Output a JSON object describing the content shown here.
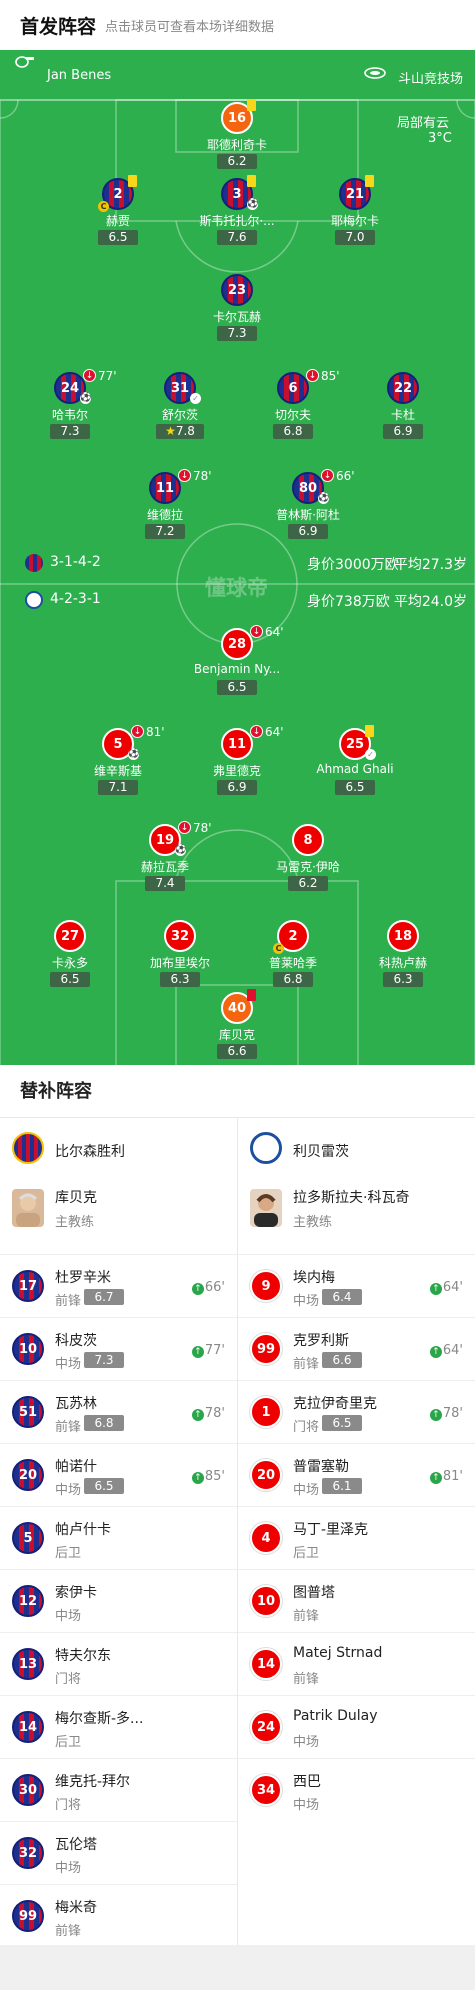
{
  "header": {
    "title": "首发阵容",
    "subtitle": "点击球员可查看本场详细数据"
  },
  "pitch": {
    "referee": "Jan Benes",
    "stadium": "斗山竞技场",
    "weather": "局部有云",
    "temperature": "3°C",
    "watermark": "懂球帝",
    "home": {
      "formation": "3-1-4-2",
      "value": "身价3000万欧",
      "avg_age": "平均27.3岁"
    },
    "away": {
      "formation": "4-2-3-1",
      "value": "身价738万欧",
      "avg_age": "平均24.0岁"
    },
    "home_players": [
      {
        "num": "16",
        "name": "耶德利奇卡",
        "rating": "6.2",
        "gk": true
      },
      {
        "num": "2",
        "name": "赫贾",
        "rating": "6.5"
      },
      {
        "num": "3",
        "name": "斯韦托扎尔·...",
        "rating": "7.6"
      },
      {
        "num": "21",
        "name": "耶梅尔卡",
        "rating": "7.0"
      },
      {
        "num": "23",
        "name": "卡尔瓦赫",
        "rating": "7.3"
      },
      {
        "num": "24",
        "name": "哈韦尔",
        "rating": "7.3",
        "sub_time": "77'"
      },
      {
        "num": "31",
        "name": "舒尔茨",
        "rating": "7.8"
      },
      {
        "num": "6",
        "name": "切尔夫",
        "rating": "6.8",
        "sub_time": "85'"
      },
      {
        "num": "22",
        "name": "卡杜",
        "rating": "6.9"
      },
      {
        "num": "11",
        "name": "维德拉",
        "rating": "7.2",
        "sub_time": "78'"
      },
      {
        "num": "80",
        "name": "普林斯·阿杜",
        "rating": "6.9",
        "sub_time": "66'"
      }
    ],
    "away_players": [
      {
        "num": "28",
        "name": "Benjamin Ny...",
        "rating": "6.5",
        "sub_time": "64'"
      },
      {
        "num": "5",
        "name": "维辛斯基",
        "rating": "7.1",
        "sub_time": "81'"
      },
      {
        "num": "11",
        "name": "弗里德克",
        "rating": "6.9",
        "sub_time": "64'"
      },
      {
        "num": "25",
        "name": "Ahmad Ghali",
        "rating": "6.5"
      },
      {
        "num": "19",
        "name": "赫拉瓦季",
        "rating": "7.4",
        "sub_time": "78'"
      },
      {
        "num": "8",
        "name": "马雷克·伊哈",
        "rating": "6.2"
      },
      {
        "num": "27",
        "name": "卡永多",
        "rating": "6.5"
      },
      {
        "num": "32",
        "name": "加布里埃尔",
        "rating": "6.3"
      },
      {
        "num": "2",
        "name": "普莱哈季",
        "rating": "6.8"
      },
      {
        "num": "18",
        "name": "科热卢赫",
        "rating": "6.3"
      },
      {
        "num": "40",
        "name": "库贝克",
        "rating": "6.6",
        "gk": true
      }
    ],
    "captain_mark": "C"
  },
  "subs": {
    "title": "替补阵容",
    "home": {
      "team": "比尔森胜利",
      "coach": {
        "name": "库贝克",
        "role": "主教练"
      },
      "players": [
        {
          "num": "17",
          "name": "杜罗辛米",
          "pos": "前锋",
          "rating": "6.7",
          "in": "66'"
        },
        {
          "num": "10",
          "name": "科皮茨",
          "pos": "中场",
          "rating": "7.3",
          "in": "77'"
        },
        {
          "num": "51",
          "name": "瓦苏林",
          "pos": "前锋",
          "rating": "6.8",
          "in": "78'"
        },
        {
          "num": "20",
          "name": "帕诺什",
          "pos": "中场",
          "rating": "6.5",
          "in": "85'"
        },
        {
          "num": "5",
          "name": "帕卢什卡",
          "pos": "后卫"
        },
        {
          "num": "12",
          "name": "索伊卡",
          "pos": "中场"
        },
        {
          "num": "13",
          "name": "特夫尔东",
          "pos": "门将"
        },
        {
          "num": "14",
          "name": "梅尔查斯-多...",
          "pos": "后卫"
        },
        {
          "num": "30",
          "name": "维克托-拜尔",
          "pos": "门将"
        },
        {
          "num": "32",
          "name": "瓦伦塔",
          "pos": "中场"
        },
        {
          "num": "99",
          "name": "梅米奇",
          "pos": "前锋"
        }
      ]
    },
    "away": {
      "team": "利贝雷茨",
      "coach": {
        "name": "拉多斯拉夫·科瓦奇",
        "role": "主教练"
      },
      "players": [
        {
          "num": "9",
          "name": "埃内梅",
          "pos": "中场",
          "rating": "6.4",
          "in": "64'"
        },
        {
          "num": "99",
          "name": "克罗利斯",
          "pos": "前锋",
          "rating": "6.6",
          "in": "64'"
        },
        {
          "num": "1",
          "name": "克拉伊奇里克",
          "pos": "门将",
          "rating": "6.5",
          "in": "78'"
        },
        {
          "num": "20",
          "name": "普雷塞勒",
          "pos": "中场",
          "rating": "6.1",
          "in": "81'"
        },
        {
          "num": "4",
          "name": "马丁-里泽克",
          "pos": "后卫"
        },
        {
          "num": "10",
          "name": "图普塔",
          "pos": "前锋"
        },
        {
          "num": "14",
          "name": "Matej Strnad",
          "pos": "前锋"
        },
        {
          "num": "24",
          "name": "Patrik Dulay",
          "pos": "中场"
        },
        {
          "num": "34",
          "name": "西巴",
          "pos": "中场"
        }
      ]
    }
  },
  "colors": {
    "pitch": "#2eaf4e",
    "home_blue": "#1d2f8f",
    "home_red": "#c8102e",
    "away_red": "#ee0000",
    "gk_orange": "#f5650f",
    "yellow_card": "#f8d71a",
    "rating_bg": "#3c6646",
    "sub_in": "#2aa64a"
  }
}
